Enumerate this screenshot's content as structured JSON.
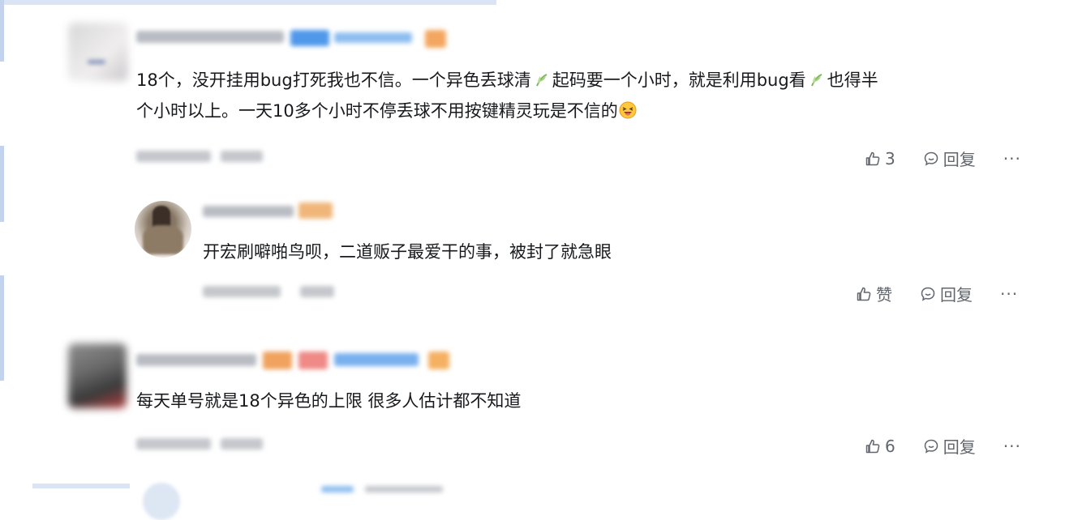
{
  "comments": [
    {
      "text_line1": "18个，没开挂用bug打死我也不信。一个异色丢球清",
      "text_line1_mid": "起码要一个小时，就是利用bug看",
      "text_line1_end": "也得半",
      "text_line2": "个小时以上。一天10多个小时不停丢球不用按键精灵玩是不信的",
      "like_count": "3",
      "reply_label": "回复",
      "more_label": "···",
      "replies": [
        {
          "text": "开宏刷噼啪鸟呗，二道贩子最爱干的事，被封了就急眼",
          "like_label": "赞",
          "reply_label": "回复",
          "more_label": "···"
        }
      ]
    },
    {
      "text": "每天单号就是18个异色的上限 很多人估计都不知道",
      "like_count": "6",
      "reply_label": "回复",
      "more_label": "···"
    }
  ],
  "colors": {
    "text": "#18191c",
    "meta": "#61666d",
    "accent_blue": "#5aa0e8",
    "badge_orange": "#f2b36a"
  },
  "icons": [
    "thumbs-up-icon",
    "reply-bubble-icon",
    "more-dots-icon",
    "leaf-emoji-icon",
    "laughing-face-emoji-icon"
  ]
}
